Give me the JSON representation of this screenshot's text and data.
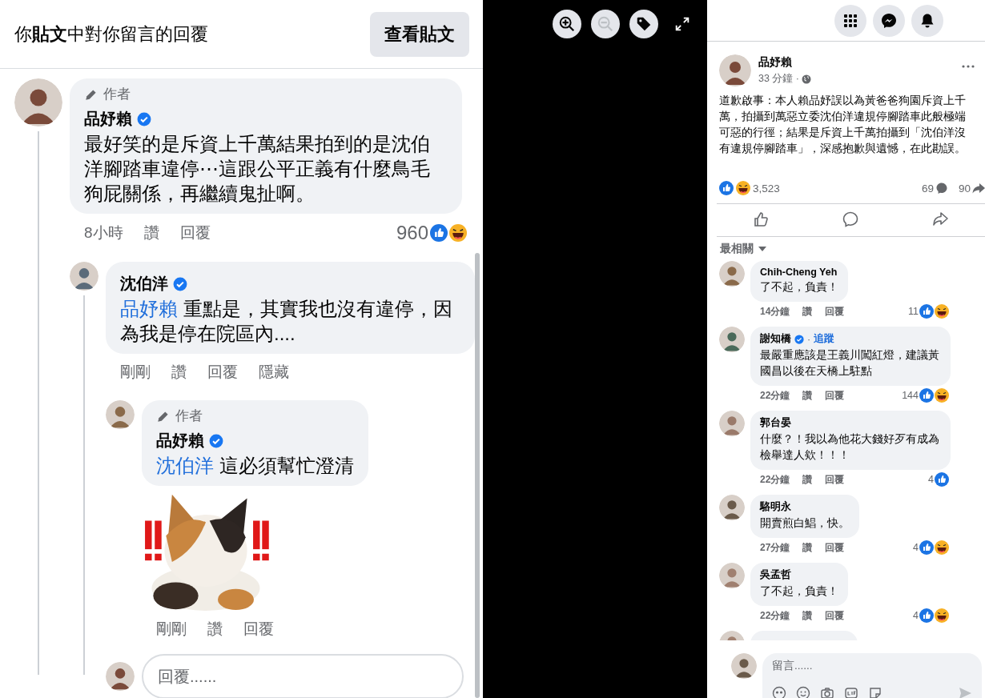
{
  "replies_panel": {
    "title": "你**貼文**中對你留言的回覆",
    "view_post_button": "查看貼文",
    "comments": [
      {
        "author_badge": "作者",
        "name": "品妤賴",
        "verified": true,
        "text": "最好笑的是斥資上千萬結果拍到的是沈伯洋腳踏車違停⋯這跟公平正義有什麼鳥毛狗屁關係，再繼續鬼扯啊。",
        "time": "8小時",
        "actions": [
          "讚",
          "回覆"
        ],
        "reaction_count": "960",
        "reactions": [
          {
            "kind": "like"
          },
          {
            "kind": "haha"
          }
        ],
        "children": [
          {
            "name": "沈伯洋",
            "verified": true,
            "mention": "品妤賴",
            "text": "重點是，其實我也沒有違停，因為我是停在院區內....",
            "time": "剛剛",
            "actions": [
              "讚",
              "回覆",
              "隱藏"
            ],
            "children": [
              {
                "author_badge": "作者",
                "name": "品妤賴",
                "verified": true,
                "mention": "沈伯洋",
                "text": "這必須幫忙澄清",
                "sticker": {
                  "kind": "picture"
                },
                "time": "剛剛",
                "actions": [
                  "讚",
                  "回覆"
                ]
              }
            ],
            "reply_box": {
              "placeholder": "回覆......"
            }
          }
        ]
      }
    ]
  },
  "viewer_toolbar": [
    {
      "kind": "zoom-in",
      "disabled": false
    },
    {
      "kind": "zoom-out",
      "disabled": true
    },
    {
      "kind": "tag",
      "disabled": false
    },
    {
      "kind": "fullscreen",
      "disabled": false
    }
  ],
  "top_bar": [
    {
      "kind": "menu"
    },
    {
      "kind": "messenger"
    },
    {
      "kind": "notifications"
    }
  ],
  "post": {
    "name": "品妤賴",
    "time": "33 分鐘 ·",
    "text": "道歉啟事：本人賴品妤誤以為黃爸爸狗園斥資上千萬，拍攝到萬惡立委沈伯洋違規停腳踏車此般極端可惡的行徑；結果是斥資上千萬拍攝到「沈伯洋沒有違規停腳踏車」，深感抱歉與遺憾，在此勘誤。",
    "reactions": [
      {
        "kind": "like"
      },
      {
        "kind": "haha"
      }
    ],
    "reaction_count": "3,523",
    "comment_count": "69",
    "share_count": "90",
    "actions": [
      {
        "kind": "like"
      },
      {
        "kind": "comment"
      },
      {
        "kind": "share"
      }
    ],
    "sort": "最相關",
    "comments": [
      {
        "name": "Chih-Cheng Yeh",
        "verified": false,
        "text": "了不起，負責！",
        "time": "14分鐘",
        "actions": [
          "讚",
          "回覆"
        ],
        "reaction_count": "11",
        "reactions": [
          {
            "kind": "like"
          },
          {
            "kind": "haha"
          }
        ]
      },
      {
        "name": "謝知橋",
        "verified": true,
        "separator": "·",
        "follow": "追蹤",
        "text": "最嚴重應該是王義川闖紅燈，建議黃國昌以後在天橋上駐點",
        "time": "22分鐘",
        "actions": [
          "讚",
          "回覆"
        ],
        "reaction_count": "144",
        "reactions": [
          {
            "kind": "like"
          },
          {
            "kind": "haha"
          }
        ]
      },
      {
        "name": "郭台晏",
        "verified": false,
        "text": "什麼？！我以為他花大錢好歹有成為檢舉達人欸！！！",
        "time": "22分鐘",
        "actions": [
          "讚",
          "回覆"
        ],
        "reaction_count": "4",
        "reactions": [
          {
            "kind": "like"
          }
        ]
      },
      {
        "name": "駱明永",
        "verified": false,
        "text": "開賣煎白鯧，快。",
        "time": "27分鐘",
        "actions": [
          "讚",
          "回覆"
        ],
        "reaction_count": "4",
        "reactions": [
          {
            "kind": "like"
          },
          {
            "kind": "haha"
          }
        ]
      },
      {
        "name": "吳孟哲",
        "verified": false,
        "text": "了不起，負責！",
        "time": "22分鐘",
        "actions": [
          "讚",
          "回覆"
        ],
        "reaction_count": "4",
        "reactions": [
          {
            "kind": "like"
          },
          {
            "kind": "haha"
          }
        ]
      }
    ],
    "partial_comment": true,
    "composer": {
      "placeholder": "留言......",
      "tools": [
        {
          "kind": "avatar"
        },
        {
          "kind": "emoji"
        },
        {
          "kind": "camera"
        },
        {
          "kind": "gif"
        },
        {
          "kind": "sticker"
        }
      ]
    }
  }
}
